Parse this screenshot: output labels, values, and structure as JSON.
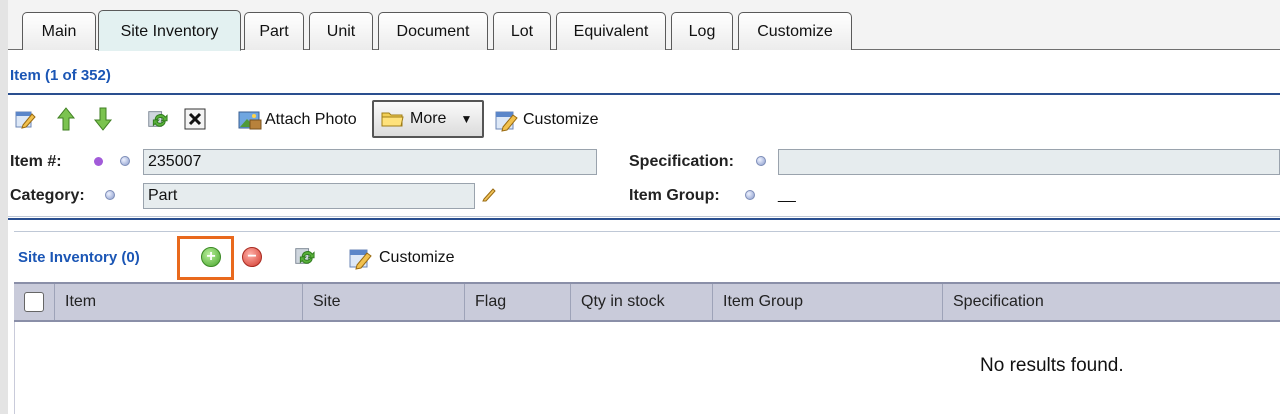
{
  "tabs": [
    {
      "label": "Main",
      "active": false
    },
    {
      "label": "Site Inventory",
      "active": true
    },
    {
      "label": "Part",
      "active": false
    },
    {
      "label": "Unit",
      "active": false
    },
    {
      "label": "Document",
      "active": false
    },
    {
      "label": "Lot",
      "active": false
    },
    {
      "label": "Equivalent",
      "active": false
    },
    {
      "label": "Log",
      "active": false
    },
    {
      "label": "Customize",
      "active": false
    }
  ],
  "item": {
    "title": "Item (1 of 352)",
    "toolbar": {
      "attach_photo": "Attach Photo",
      "more": "More",
      "customize": "Customize"
    },
    "fields": {
      "item_number_label": "Item #:",
      "item_number_value": "235007",
      "category_label": "Category:",
      "category_value": "Part",
      "specification_label": "Specification:",
      "specification_value": "",
      "item_group_label": "Item Group:",
      "item_group_value": "__"
    }
  },
  "site_inventory": {
    "title": "Site Inventory (0)",
    "customize": "Customize",
    "columns": [
      "Item",
      "Site",
      "Flag",
      "Qty in stock",
      "Item Group",
      "Specification"
    ],
    "empty_message": "No results found."
  },
  "colors": {
    "link_blue": "#1b56b5",
    "header_rule": "#2a4f8f",
    "table_header": "#c9cbda",
    "highlight": "#e9691d",
    "active_tab": "#e3f1f1"
  }
}
